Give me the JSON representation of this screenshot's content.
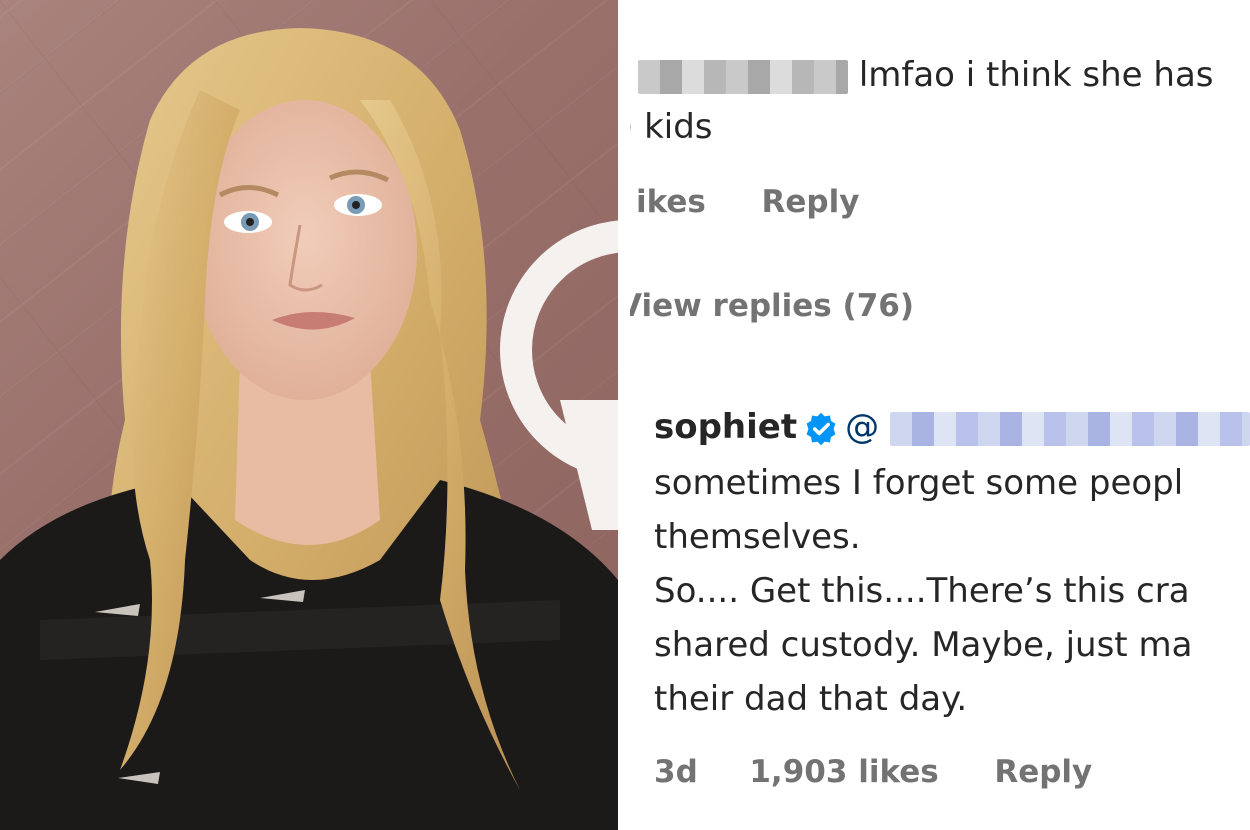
{
  "comment_one": {
    "text": "lmfao i think she has",
    "text_line2": "kids",
    "likes_label": "ikes",
    "reply_label": "Reply",
    "view_replies": "View replies (76)"
  },
  "comment_two": {
    "username": "sophiet",
    "mention_prefix": "@",
    "line1": "sometimes I forget some peopl",
    "line2": "themselves.",
    "line3": "So.... Get this....There’s this cra",
    "line4": "shared custody. Maybe, just ma",
    "line5": "their dad that day.",
    "time": "3d",
    "likes": "1,903 likes",
    "reply_label": "Reply"
  },
  "icons": {
    "verified": "verified-badge-icon"
  },
  "colors": {
    "verified_blue": "#0095f6",
    "mention_blue": "#00376b",
    "meta_grey": "#737373"
  }
}
